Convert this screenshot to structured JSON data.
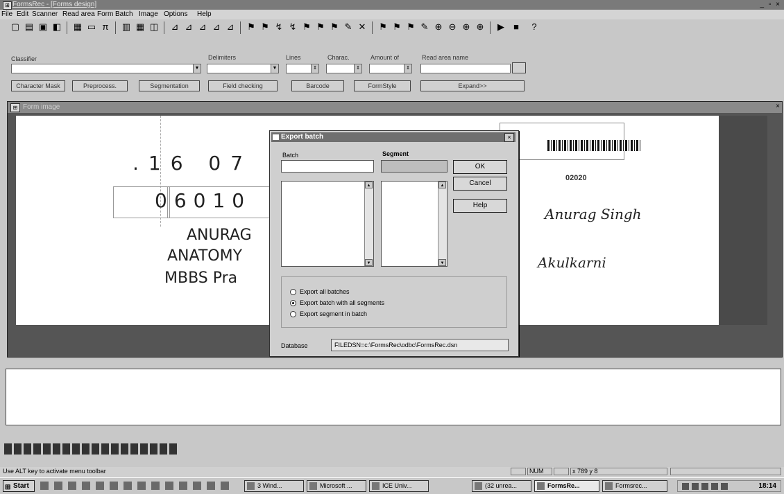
{
  "window": {
    "title": "FormsRec - [Forms design]",
    "controls": "_ ▫ ×"
  },
  "menu": [
    "File",
    "Edit",
    "Scanner",
    "Read area",
    "Form",
    "Batch",
    "Image",
    "Options",
    "Help"
  ],
  "params": {
    "classifier": "Classifier",
    "delimiters": "Delimiters",
    "lines": "Lines",
    "charac": "Charac.",
    "amount_of": "Amount of",
    "read_area_name": "Read area name"
  },
  "buttons": {
    "character_mask": "Character Mask",
    "preprocessing": "Preprocess.",
    "segmentation": "Segmentation",
    "field_checking": "Field checking",
    "barcode": "Barcode",
    "formstyle": "FormStyle",
    "expand": "Expand>>"
  },
  "document": {
    "window_title": "Form image",
    "hand": {
      "number1": ".16 07 0",
      "number2": "06010",
      "name": "ANURAG",
      "dept": "ANATOMY",
      "course": "MBBS  Pra",
      "sig1": "Anurag Singh",
      "sig2": "Akulkarni",
      "code": "02020"
    }
  },
  "dialog": {
    "title": "Export batch",
    "batch_label": "Batch",
    "segment_label": "Segment",
    "ok": "OK",
    "cancel": "Cancel",
    "help": "Help",
    "radios": [
      {
        "label": "Export all batches",
        "selected": false
      },
      {
        "label": "Export batch with all segments",
        "selected": true
      },
      {
        "label": "Export segment in batch",
        "selected": false
      }
    ],
    "database_label": "Database",
    "database_value": "FILEDSN=c:\\FormsRec\\odbc\\FormsRec.dsn"
  },
  "statusbar": {
    "message": "Use ALT key to activate menu toolbar",
    "num": "NUM",
    "coords": "x 789 y 8"
  },
  "taskbar": {
    "start": "Start",
    "tasks": [
      "3 Wind...",
      "Microsoft ...",
      "ICE Univ...",
      "(32 unrea...",
      "FormsRe...",
      "Formsrec..."
    ],
    "clock": "18:14"
  },
  "progress_segments": 18
}
